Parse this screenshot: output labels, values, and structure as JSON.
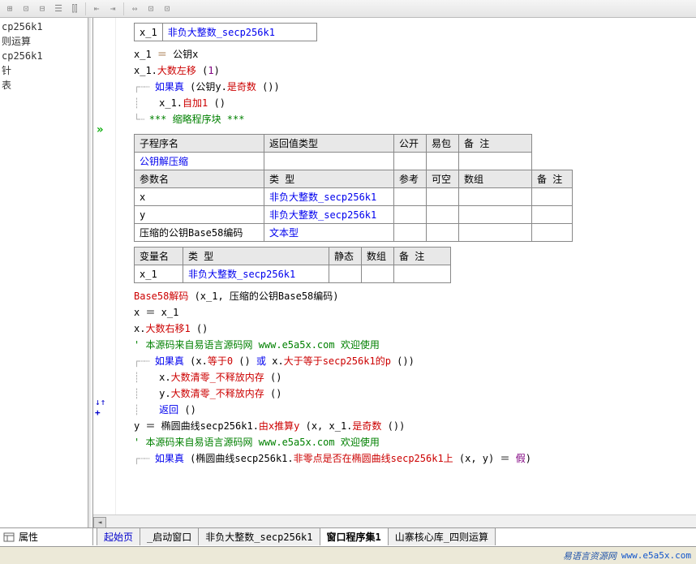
{
  "toolbar": {
    "icons": [
      "⊞",
      "⊡",
      "⊟",
      "☰",
      "⫿⫿",
      "⇤",
      "⇥",
      "",
      "⇔",
      "⊡",
      "⊡"
    ]
  },
  "sidebar": {
    "items": [
      "",
      "cp256k1",
      "则运算",
      "",
      "cp256k1",
      "",
      "针",
      "",
      "",
      "表"
    ]
  },
  "table1": {
    "row_var": "x_1",
    "row_type": "非负大整数_secp256k1"
  },
  "code1": {
    "l1a": "x_1",
    "l1b": " ＝ ",
    "l1c": "公钥x",
    "l2a": "x_1.",
    "l2b": "大数左移",
    "l2c": " (",
    "l2d": "1",
    "l2e": ")",
    "l3a": "如果真",
    "l3b": " (",
    "l3c": "公钥y.",
    "l3d": "是奇数",
    "l3e": " ())",
    "l4a": "x_1.",
    "l4b": "自加1",
    "l4c": " ()",
    "l5a": "*** 缩略程序块 ***"
  },
  "table2": {
    "h1": "子程序名",
    "h2": "返回值类型",
    "h3": "公开",
    "h4": "易包",
    "h5": "备 注",
    "r1_name": "公钥解压缩",
    "h6": "参数名",
    "h7": "类 型",
    "h8": "参考",
    "h9": "可空",
    "h10": "数组",
    "h11": "备 注",
    "r2_name": "x",
    "r2_type": "非负大整数_secp256k1",
    "r3_name": "y",
    "r3_type": "非负大整数_secp256k1",
    "r4_name": "压缩的公钥Base58编码",
    "r4_type": "文本型"
  },
  "table3": {
    "h1": "变量名",
    "h2": "类 型",
    "h3": "静态",
    "h4": "数组",
    "h5": "备 注",
    "r1_name": "x_1",
    "r1_type": "非负大整数_secp256k1"
  },
  "code2": {
    "l1a": "Base58解码",
    "l1b": " (x_1, 压缩的公钥Base58编码)",
    "l2a": "x ＝ x_1",
    "l3a": "x.",
    "l3b": "大数右移1",
    "l3c": " ()",
    "l4a": "' 本源码来自易语言源码网 www.e5a5x.com  欢迎使用",
    "l5a": "如果真",
    "l5b": " (x.",
    "l5c": "等于0",
    "l5d": " () ",
    "l5e": "或",
    "l5f": " x.",
    "l5g": "大于等于secp256k1的p",
    "l5h": " ())",
    "l6a": "x.",
    "l6b": "大数清零_不释放内存",
    "l6c": " ()",
    "l7a": "y.",
    "l7b": "大数清零_不释放内存",
    "l7c": " ()",
    "l8a": "返回",
    "l8b": " ()",
    "l9a": "y ＝ 椭圆曲线secp256k1.",
    "l9b": "由x推算y",
    "l9c": " (x, x_1.",
    "l9d": "是奇数",
    "l9e": " ())",
    "l10a": "' 本源码来自易语言源码网 www.e5a5x.com  欢迎使用",
    "l11a": "如果真",
    "l11b": " (椭圆曲线secp256k1.",
    "l11c": "非零点是否在椭圆曲线secp256k1上",
    "l11d": " (x, y) ＝ ",
    "l11e": "假",
    "l11f": ")"
  },
  "leftBottom": {
    "label": "属性"
  },
  "tabs": {
    "t1": "起始页",
    "t2": "_启动窗口",
    "t3": "非负大整数_secp256k1",
    "t4": "窗口程序集1",
    "t5": "山寨核心库_四则运算"
  },
  "footer": {
    "brand": "易语言资源网",
    "url": "www.e5a5x.com"
  }
}
